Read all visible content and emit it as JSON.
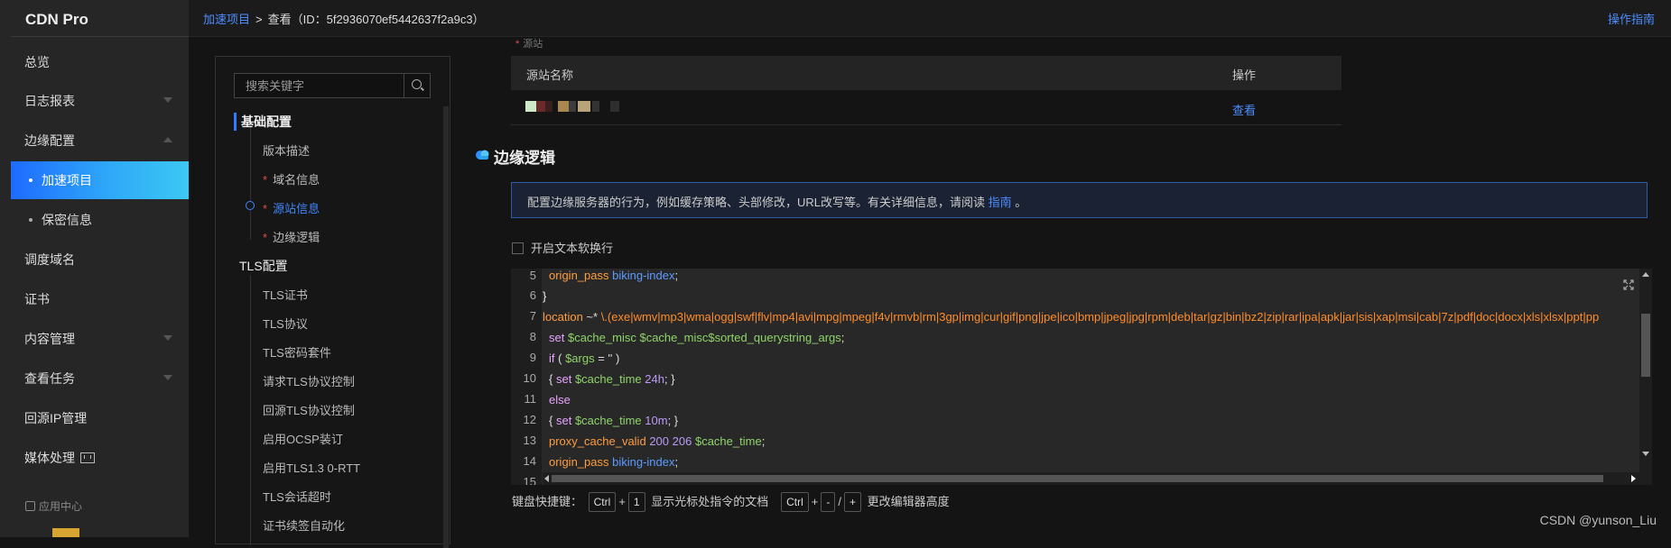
{
  "app": {
    "title": "CDN Pro"
  },
  "nav": {
    "items": [
      {
        "label": "总览"
      },
      {
        "label": "日志报表"
      },
      {
        "label": "边缘配置"
      },
      {
        "label": "加速项目"
      },
      {
        "label": "保密信息"
      },
      {
        "label": "调度域名"
      },
      {
        "label": "证书"
      },
      {
        "label": "内容管理"
      },
      {
        "label": "查看任务"
      },
      {
        "label": "回源IP管理"
      },
      {
        "label": "媒体处理"
      }
    ],
    "app_center": "应用中心"
  },
  "breadcrumb": {
    "link": "加速项目",
    "separator": ">",
    "current": "查看（ID：5f2936070ef5442637f2a9c3）"
  },
  "header": {
    "guide": "操作指南"
  },
  "outline": {
    "search_placeholder": "搜索关键字",
    "groups": [
      {
        "label": "基础配置",
        "items": [
          {
            "label": "版本描述",
            "required": ""
          },
          {
            "label": "域名信息",
            "required": "*"
          },
          {
            "label": "源站信息",
            "required": "*"
          },
          {
            "label": "边缘逻辑",
            "required": "*"
          }
        ]
      },
      {
        "label": "TLS配置",
        "items": [
          {
            "label": "TLS证书"
          },
          {
            "label": "TLS协议"
          },
          {
            "label": "TLS密码套件"
          },
          {
            "label": "请求TLS协议控制"
          },
          {
            "label": "回源TLS协议控制"
          },
          {
            "label": "启用OCSP装订"
          },
          {
            "label": "启用TLS1.3 0-RTT"
          },
          {
            "label": "TLS会话超时"
          },
          {
            "label": "证书续签自动化"
          }
        ]
      }
    ]
  },
  "origin": {
    "note_star": "*",
    "note": "源站",
    "table": {
      "columns": [
        "源站名称",
        "操作"
      ],
      "rows": [
        {
          "action": "查看"
        }
      ]
    }
  },
  "edge_logic": {
    "title": "边缘逻辑",
    "info": "配置边缘服务器的行为，例如缓存策略、头部修改，URL改写等。有关详细信息，请阅读",
    "info_link": "指南",
    "info_end": "。",
    "wrap_label": "开启文本软换行"
  },
  "editor": {
    "line_numbers": [
      "5",
      "6",
      "7",
      "8",
      "9",
      "10",
      "11",
      "12",
      "13",
      "14",
      "15"
    ],
    "t": {
      "origin_pass": "origin_pass",
      "biking_index": "biking-index",
      "semi": ";",
      "rbrace": "}",
      "location": "location",
      "loc_op": " ~* ",
      "regex": "\\.(exe|wmv|mp3|wma|ogg|swf|flv|mp4|avi|mpg|mpeg|f4v|rmvb|rm|3gp|img|cur|gif|png|jpe|ico|bmp|jpeg|jpg|rpm|deb|tar|gz|bin|bz2|zip|rar|ipa|apk|jar|sis|xap|msi|cab|7z|pdf|doc|docx|xls|xlsx|ppt|pptx|txt|csv",
      "set": "set",
      "cache_misc": "$cache_misc",
      "cache_misc_sorted": "$cache_misc$sorted_querystring_args",
      "if": "if",
      "lparen": "( ",
      "args": "$args",
      "eq_empty": " = '' )",
      "lbrace": "{ ",
      "cache_time": "$cache_time",
      "v24h": "24h",
      "close_brace": "; }",
      "else": "else",
      "v10m": "10m",
      "proxy_cache_valid": "proxy_cache_valid",
      "n200": "200",
      "n206": "206"
    }
  },
  "shortcuts": {
    "label": "键盘快捷键：",
    "ctrl": "Ctrl",
    "plus": "+",
    "one": "1",
    "doc_text": "显示光标处指令的文档",
    "minus": "-",
    "slash": "/",
    "height_text": "更改编辑器高度"
  },
  "watermark": "CSDN @yunson_Liu"
}
